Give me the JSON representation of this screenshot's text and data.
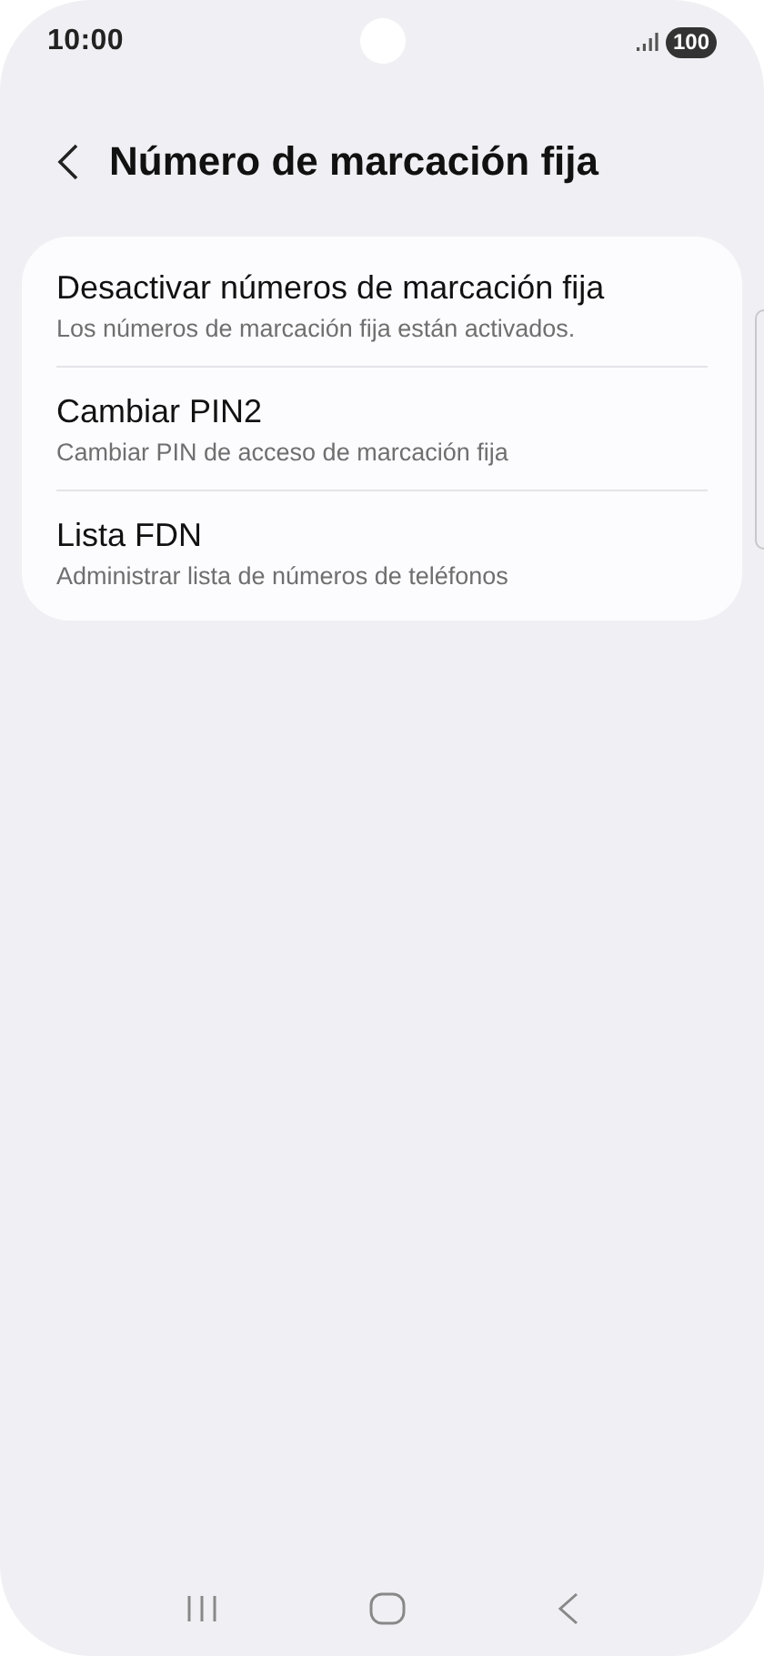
{
  "status_bar": {
    "time": "10:00",
    "battery": "100"
  },
  "header": {
    "title": "Número de marcación fija"
  },
  "settings": [
    {
      "title": "Desactivar números de marcación fija",
      "subtitle": "Los números de marcación fija están activados."
    },
    {
      "title": "Cambiar PIN2",
      "subtitle": "Cambiar PIN de acceso de marcación fija"
    },
    {
      "title": "Lista FDN",
      "subtitle": "Administrar lista de números de teléfonos"
    }
  ]
}
